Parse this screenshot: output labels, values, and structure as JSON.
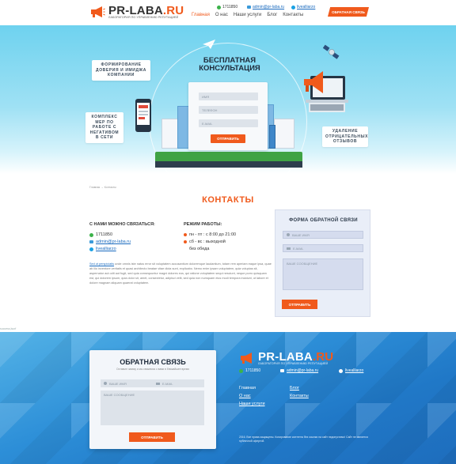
{
  "header": {
    "logo_pr": "PR-",
    "logo_laba": "LABA",
    "logo_ru": ".RU",
    "logo_subtitle": "ЛАБОРАТОРИЯ ПО УПРАВЛЕНИЮ РЕПУТАЦИЕЙ",
    "phone": "1711850",
    "email": "admin@pr-laba.ru",
    "skype": "livealliarzo",
    "nav": [
      "Главная",
      "О нас",
      "Наши услуги",
      "Блог",
      "Контакты"
    ],
    "nav_active_index": 0,
    "cta": "ОБРАТНАЯ СВЯЗЬ"
  },
  "hero": {
    "title": "БЕСПЛАТНАЯ КОНСУЛЬТАЦИЯ",
    "bubble_left_top": "ФОРМИРОВАНИЕ ДОВЕРИЯ И ИМИДЖА КОМПАНИИ",
    "bubble_left_bottom": "КОМПЛЕКС МЕР ПО РАБОТЕ С НЕГАТИВОМ В СЕТИ",
    "bubble_right": "УДАЛЕНИЕ ОТРИЦАТЕЛЬНЫХ ОТЗЫВОВ",
    "form": {
      "name_placeholder": "ИМЯ",
      "phone_placeholder": "ТЕЛЕФОН",
      "email_placeholder": "E-MAIL",
      "submit": "ОТПРАВИТЬ"
    }
  },
  "breadcrumb": "Главная  →  Контакты",
  "page_title": "КОНТАКТЫ",
  "contacts": {
    "connect_label": "С НАМИ МОЖНО СВЯЗАТЬСЯ:",
    "phone": "1711850",
    "email": "admin@pr-laba.ru",
    "skype": "livealliarzo",
    "hours_label": "РЕЖИМ РАБОТЫ:",
    "hours": [
      "пн - пт : с 8:00 до 21:00",
      "сб - вс : выходной",
      "без обеда"
    ],
    "lorem_link": "Sed ut perspiciatis",
    "lorem": " unde omnis iste natus error sit voluptatem accusantium doloremque laudantium, totam rem aperiam eaque ipsa, quae ab illo inventore veritatis et quasi architecto beatae vitae dicta sunt, explicabo. Nemo enim ipsam voluptatem, quia voluptas sit, aspernatur aut odit aut fugit, sed quia consequuntur magni dolores eos, qui ratione voluptatem sequi nesciunt, neque porro quisquam est, qui dolorem ipsum, quia dolor sit, amet, consectetur, adipisci velit, sed quia non numquam eius modi tempora incidunt, ut labore et dolore magnam aliquam quaerat voluptatem."
  },
  "side_form": {
    "title": "ФОРМА ОБРАТНОЙ СВЯЗИ",
    "name_placeholder": "ВАШЕ ИМЯ",
    "email_placeholder": "E-MAIL",
    "message_placeholder": "ВАШЕ СООБЩЕНИЕ",
    "submit": "ОТПРАВИТЬ"
  },
  "tiny_note": "success,lsurf",
  "footer": {
    "form_title": "ОБРАТНАЯ СВЯЗЬ",
    "form_subtitle": "Оставьте заявку и мы свяжемся с вами в ближайшее время",
    "name_placeholder": "ВАШЕ ИМЯ",
    "email_placeholder": "E-MAIL",
    "message_placeholder": "ВАШЕ СООБЩЕНИЕ",
    "submit": "ОТПРАВИТЬ",
    "phone": "1711850",
    "email": "admin@pr-laba.ru",
    "skype": "livealliarzo",
    "nav_left": [
      "Главная",
      "О нас",
      "Наши услуги"
    ],
    "nav_right": [
      "Блог",
      "Контакты"
    ],
    "copyright": "2016. Все права защищены. Копирование контента без ссылки на сайт недопустимо! Сайт не является публичной офертой."
  },
  "colors": {
    "accent": "#f05a1c",
    "link": "#1a6bbf",
    "footer_blue": "#2d8fd8"
  }
}
